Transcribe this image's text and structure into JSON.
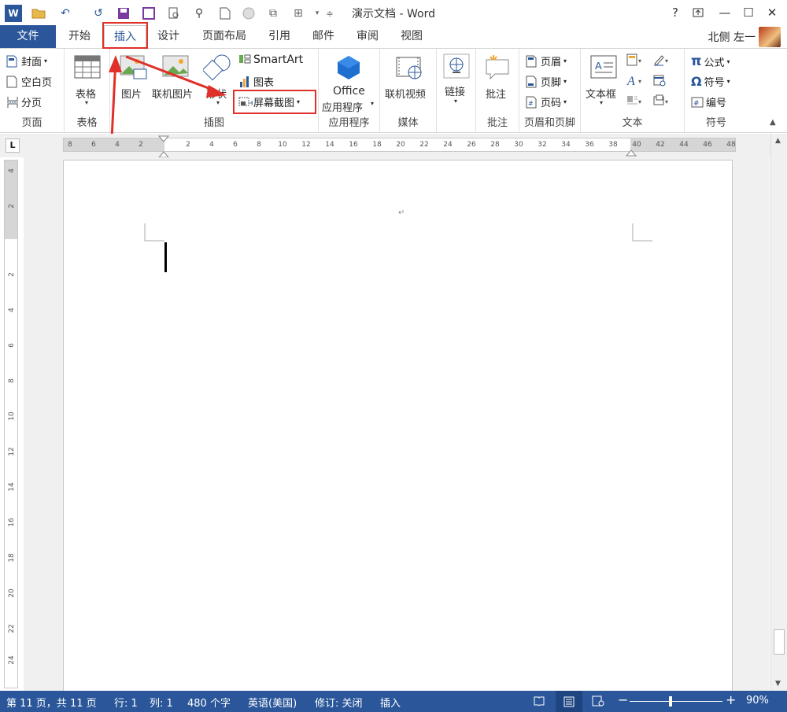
{
  "window": {
    "title": "演示文档 - Word",
    "help": "?"
  },
  "tabs": {
    "file": "文件",
    "items": [
      "开始",
      "插入",
      "设计",
      "页面布局",
      "引用",
      "邮件",
      "审阅",
      "视图"
    ],
    "active": "插入"
  },
  "user": "北侧 左一",
  "ribbon": {
    "pages": {
      "label": "页面",
      "cover": "封面",
      "blank": "空白页",
      "break": "分页"
    },
    "tables": {
      "label": "表格",
      "table": "表格"
    },
    "illustrations": {
      "label": "插图",
      "picture": "图片",
      "online_picture": "联机图片",
      "shapes": "形状",
      "smartart": "SmartArt",
      "chart": "图表",
      "screenshot": "屏幕截图"
    },
    "apps": {
      "label": "应用程序",
      "office_line1": "Office",
      "office_line2": "应用程序"
    },
    "media": {
      "label": "媒体",
      "online_video": "联机视频"
    },
    "links": {
      "label": "",
      "link": "链接"
    },
    "comments": {
      "label": "批注",
      "comment": "批注"
    },
    "header_footer": {
      "label": "页眉和页脚",
      "header": "页眉",
      "footer": "页脚",
      "page_number": "页码"
    },
    "text": {
      "label": "文本",
      "textbox": "文本框"
    },
    "symbols": {
      "label": "符号",
      "equation": "公式",
      "symbol": "符号",
      "number": "编号"
    }
  },
  "ruler": {
    "h_ticks": [
      "8",
      "6",
      "4",
      "2",
      "2",
      "4",
      "6",
      "8",
      "10",
      "12",
      "14",
      "16",
      "18",
      "20",
      "22",
      "24",
      "26",
      "28",
      "30",
      "32",
      "34",
      "36",
      "38",
      "40",
      "42",
      "44",
      "46",
      "48"
    ],
    "v_ticks": [
      "4",
      "2",
      "2",
      "4",
      "6",
      "8",
      "10",
      "12",
      "14",
      "16",
      "18",
      "20",
      "22",
      "24"
    ],
    "corner": "L"
  },
  "status": {
    "page": "第 11 页，共 11 页",
    "row": "行: 1",
    "col": "列: 1",
    "words": "480 个字",
    "lang": "英语(美国)",
    "track": "修订: 关闭",
    "mode": "插入",
    "zoom": "90%"
  },
  "colors": {
    "accent": "#2b579a",
    "annotation": "#e0302a"
  }
}
